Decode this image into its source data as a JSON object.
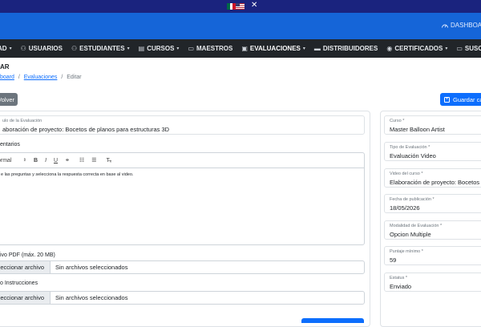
{
  "topbar": {
    "close_label": "✕"
  },
  "header": {
    "dashboard_label": "DASHBOARD"
  },
  "nav": {
    "items": [
      {
        "label": "AD",
        "icon": "none"
      },
      {
        "label": "USUARIOS",
        "icon": "users-icon"
      },
      {
        "label": "ESTUDIANTES",
        "icon": "student-icon"
      },
      {
        "label": "CURSOS",
        "icon": "book-icon"
      },
      {
        "label": "MAESTROS",
        "icon": "teacher-icon"
      },
      {
        "label": "EVALUACIONES",
        "icon": "clipboard-icon"
      },
      {
        "label": "DISTRIBUIDORES",
        "icon": "truck-icon"
      },
      {
        "label": "CERTIFICADOS",
        "icon": "certificate-icon"
      },
      {
        "label": "SUSCRIPCIONES",
        "icon": "card-icon"
      }
    ]
  },
  "page": {
    "title": "AR"
  },
  "breadcrumb": {
    "dashboard": "board",
    "evaluaciones": "Evaluaciones",
    "separator": "/",
    "current": "Editar"
  },
  "buttons": {
    "back": "Volver",
    "save": "Guardar ca"
  },
  "form": {
    "titulo_label": "ulo de la Evaluación",
    "titulo_value": "aboración de proyecto: Bocetos de planos para estructuras 3D",
    "comentarios_label": "entarios",
    "editor_format": "ormal",
    "editor_text": "e las preguntas y selecciona la respuesta correcta en base al video.",
    "pdf_label": "ivo PDF (máx. 20 MB)",
    "pdf_button": "eccionar archivo",
    "pdf_status": "Sin archivos seleccionados",
    "instrucciones_label": "o Instrucciones",
    "instrucciones_button": "eccionar archivo",
    "instrucciones_status": "Sin archivos seleccionados"
  },
  "sidebar_fields": [
    {
      "label": "Curso *",
      "value": "Master Balloon Artist"
    },
    {
      "label": "Tipo de Evaluación *",
      "value": "Evaluación Video"
    },
    {
      "label": "Video del curso *",
      "value": "Elaboración de proyecto: Bocetos d"
    },
    {
      "label": "Fecha de publicación *",
      "value": "18/05/2026"
    },
    {
      "label": "Modalidad de Evaluación *",
      "value": "Opcion Multiple"
    },
    {
      "label": "Puntaje mínimo *",
      "value": "59"
    },
    {
      "label": "Estatus *",
      "value": "Enviado"
    }
  ],
  "colors": {
    "topbar": "#1a237e",
    "header": "#1565d8",
    "nav": "#212529",
    "primary": "#0d6efd",
    "secondary": "#6c757d"
  }
}
